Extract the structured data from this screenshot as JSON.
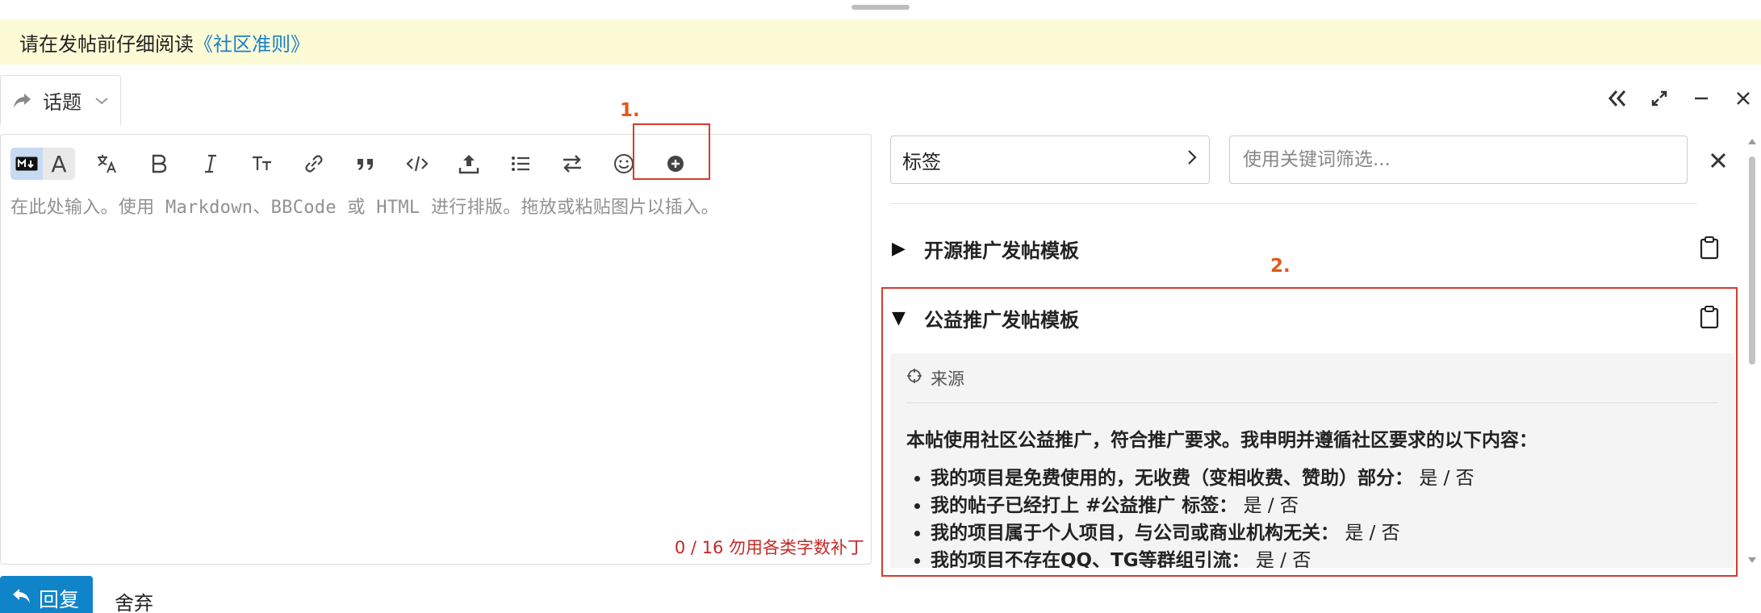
{
  "banner": {
    "text": "请在发帖前仔细阅读",
    "link": "《社区准则》"
  },
  "composer": {
    "topic_label": "话题",
    "placeholder": "在此处输入。使用 Markdown、BBCode 或 HTML 进行排版。拖放或粘贴图片以插入。",
    "counter": "0 / 16 勿用各类字数补丁"
  },
  "annotations": {
    "label1": "1.",
    "label2": "2."
  },
  "side": {
    "tag_select": "标签",
    "filter_placeholder": "使用关键词筛选...",
    "templates": [
      {
        "title": "开源推广发帖模板",
        "expanded": false
      },
      {
        "title": "公益推广发帖模板",
        "expanded": true
      }
    ],
    "source_label": "来源",
    "declaration": "本帖使用社区公益推广，符合推广要求。我申明并遵循社区要求的以下内容：",
    "checklist": [
      {
        "q": "我的项目是免费使用的，无收费（变相收费、赞助）部分：",
        "a": "是 / 否"
      },
      {
        "q": "我的帖子已经打上 #公益推广 标签：",
        "a": "是 / 否"
      },
      {
        "q": "我的项目属于个人项目，与公司或商业机构无关：",
        "a": "是 / 否"
      },
      {
        "q": "我的项目不存在QQ、TG等群组引流：",
        "a": "是 / 否"
      }
    ]
  },
  "footer": {
    "reply": "回复",
    "discard": "舍弃"
  },
  "colors": {
    "primary": "#0f84c9",
    "annotation": "#d83a2e",
    "banner": "#fdfbd6",
    "counter": "#c62828"
  }
}
